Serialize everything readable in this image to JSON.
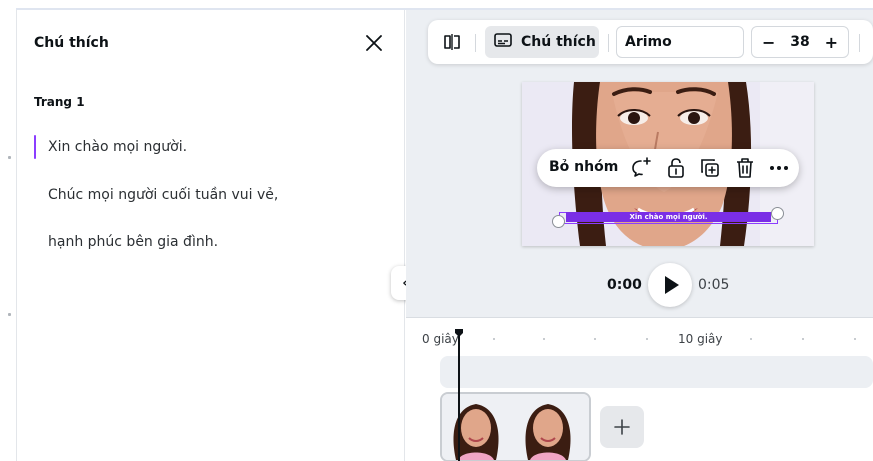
{
  "panel": {
    "title": "Chú thích",
    "page_label": "Trang 1",
    "captions": [
      "Xin chào mọi người.",
      "Chúc mọi người cuối tuần vui vẻ,",
      "hạnh phúc bên gia đình."
    ]
  },
  "toolbar": {
    "caption_label": "Chú thích",
    "font_name": "Arimo",
    "font_size": "38",
    "decrease": "−",
    "increase": "+"
  },
  "context_menu": {
    "ungroup_label": "Bỏ nhóm"
  },
  "canvas": {
    "selected_caption": "Xin chào mọi người."
  },
  "playback": {
    "current_time": "0:00",
    "total_time": "0:05"
  },
  "timeline": {
    "label_start": "0 giây",
    "label_mid": "10 giây"
  },
  "colors": {
    "accent": "#8b3dff",
    "selection_fill": "#7a2ee6"
  }
}
